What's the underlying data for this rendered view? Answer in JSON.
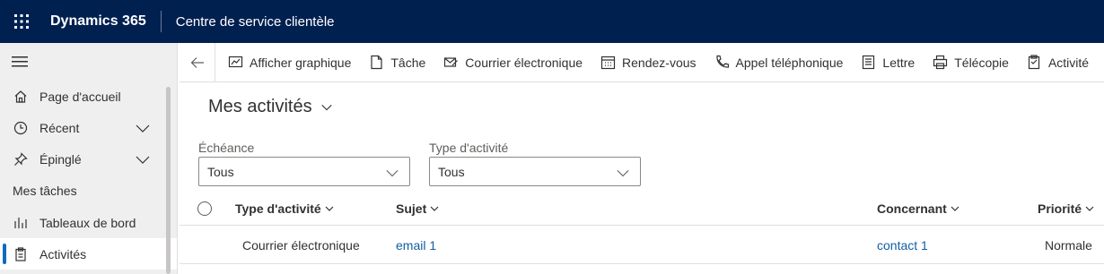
{
  "topbar": {
    "product": "Dynamics 365",
    "app_name": "Centre de service clientèle"
  },
  "sidebar": {
    "items": [
      {
        "label": "Page d'accueil",
        "icon": "home-icon"
      },
      {
        "label": "Récent",
        "icon": "clock-icon",
        "expandable": true
      },
      {
        "label": "Épinglé",
        "icon": "pin-icon",
        "expandable": true
      }
    ],
    "section_title": "Mes tâches",
    "section_items": [
      {
        "label": "Tableaux de bord",
        "icon": "dashboard-icon"
      },
      {
        "label": "Activités",
        "icon": "clipboard-icon",
        "active": true
      }
    ]
  },
  "commandbar": {
    "buttons": [
      {
        "label": "Afficher graphique",
        "icon": "chart-icon"
      },
      {
        "label": "Tâche",
        "icon": "task-icon"
      },
      {
        "label": "Courrier électronique",
        "icon": "email-icon"
      },
      {
        "label": "Rendez-vous",
        "icon": "calendar-icon"
      },
      {
        "label": "Appel téléphonique",
        "icon": "phone-icon"
      },
      {
        "label": "Lettre",
        "icon": "letter-icon"
      },
      {
        "label": "Télécopie",
        "icon": "fax-icon"
      },
      {
        "label": "Activité",
        "icon": "activity-icon"
      }
    ]
  },
  "view": {
    "title": "Mes activités"
  },
  "filters": {
    "due": {
      "label": "Échéance",
      "value": "Tous"
    },
    "activity_type": {
      "label": "Type d'activité",
      "value": "Tous"
    }
  },
  "grid": {
    "columns": [
      "Type d'activité",
      "Sujet",
      "Concernant",
      "Priorité"
    ],
    "rows": [
      {
        "type": "Courrier électronique",
        "subject": "email 1",
        "regarding": "contact 1",
        "priority": "Normale"
      }
    ]
  },
  "colors": {
    "topbar": "#002050",
    "link": "#115ea3",
    "accent": "#0f6cbd"
  }
}
